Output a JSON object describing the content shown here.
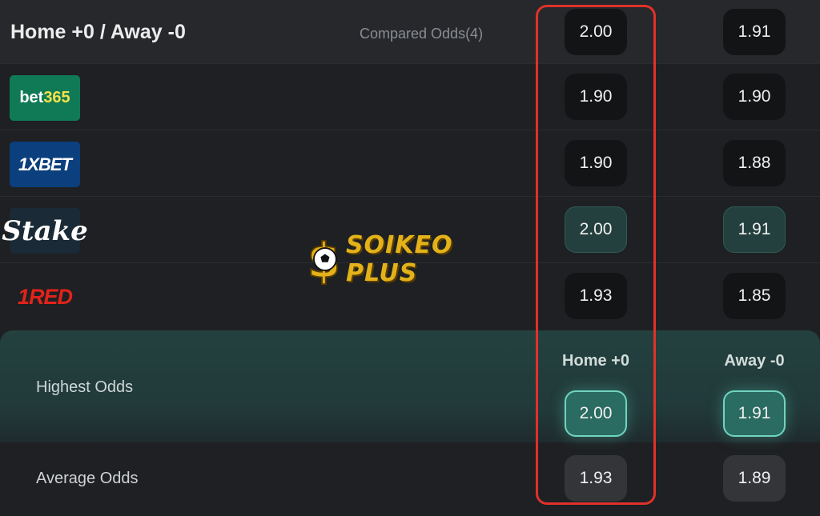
{
  "header": {
    "title": "Home +0 / Away -0",
    "compared": "Compared Odds(4)",
    "odds": [
      "2.00",
      "1.91"
    ]
  },
  "bookmakers": [
    {
      "name": "bet365",
      "logo_text_a": "bet",
      "logo_text_b": "365",
      "home": "1.90",
      "away": "1.90"
    },
    {
      "name": "1XBET",
      "logo_text": "1XBET",
      "home": "1.90",
      "away": "1.88"
    },
    {
      "name": "Stake",
      "logo_text": "Stake",
      "home": "2.00",
      "away": "1.91"
    },
    {
      "name": "RED",
      "logo_text": "1RED",
      "home": "1.93",
      "away": "1.85"
    }
  ],
  "highest": {
    "label": "Highest Odds",
    "home_head": "Home +0",
    "away_head": "Away -0",
    "home": "2.00",
    "away": "1.91"
  },
  "average": {
    "label": "Average Odds",
    "home": "1.93",
    "away": "1.89"
  },
  "watermark": {
    "text": "SOIKEO PLUS"
  },
  "colors": {
    "highlight_frame": "#e0312a",
    "best_odds": "#2a6b62",
    "bet365": "#0f7a55",
    "xbet": "#0b3f7d",
    "red_brand": "#e2231a"
  }
}
